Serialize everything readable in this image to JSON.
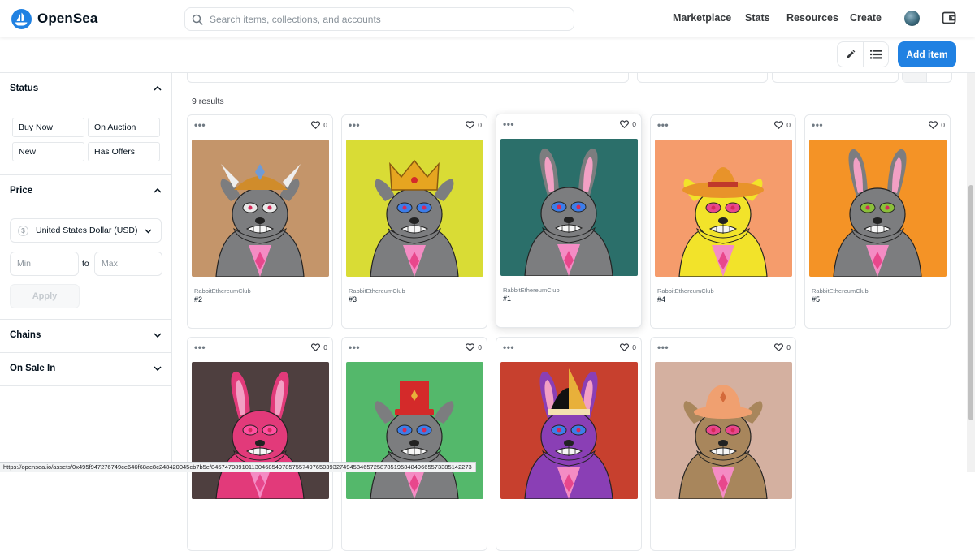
{
  "brand": {
    "name": "OpenSea",
    "accent": "#2081e2"
  },
  "search": {
    "placeholder": "Search items, collections, and accounts"
  },
  "nav": {
    "items": [
      "Marketplace",
      "Stats",
      "Resources",
      "Create"
    ]
  },
  "actions": {
    "add_item": "Add item",
    "edit_icon": "pencil-icon",
    "list_icon": "list-icon"
  },
  "sidebar": {
    "status": {
      "title": "Status",
      "options": [
        "Buy Now",
        "On Auction",
        "New",
        "Has Offers"
      ]
    },
    "price": {
      "title": "Price",
      "currency": "United States Dollar (USD)",
      "currency_symbol": "$",
      "min_placeholder": "Min",
      "max_placeholder": "Max",
      "to_label": "to",
      "apply_label": "Apply"
    },
    "chains": {
      "title": "Chains"
    },
    "on_sale_in": {
      "title": "On Sale In"
    }
  },
  "main": {
    "results_label": "9 results",
    "cards": [
      {
        "collection": "RabbitEthereumClub",
        "name": "#2",
        "likes": "0",
        "bg": "#c4956a",
        "fur": "#7c7d7f",
        "accent": "#e8e8e8",
        "hat": "viking-helmet",
        "hatColor": "#d08c2b"
      },
      {
        "collection": "RabbitEthereumClub",
        "name": "#3",
        "likes": "0",
        "bg": "#d9dc35",
        "fur": "#7c7d7f",
        "accent": "#3d7de8",
        "hat": "crown",
        "hatColor": "#e6a520"
      },
      {
        "collection": "RabbitEthereumClub",
        "name": "#1",
        "likes": "0",
        "bg": "#2b6f6a",
        "fur": "#7c7d7f",
        "accent": "#3d7de8",
        "hat": "none",
        "hatColor": "#7c7d7f"
      },
      {
        "collection": "RabbitEthereumClub",
        "name": "#4",
        "likes": "0",
        "bg": "#f59c6c",
        "fur": "#f2e32a",
        "accent": "#e8478c",
        "hat": "sombrero",
        "hatColor": "#e8932a"
      },
      {
        "collection": "RabbitEthereumClub",
        "name": "#5",
        "likes": "0",
        "bg": "#f49326",
        "fur": "#7c7d7f",
        "accent": "#8bbf3a",
        "hat": "none",
        "hatColor": "#7c7d7f"
      },
      {
        "collection": "",
        "name": "",
        "likes": "0",
        "bg": "#4e3f3f",
        "fur": "#e23a7a",
        "accent": "#ff4fa0",
        "hat": "none",
        "hatColor": "#e23a7a"
      },
      {
        "collection": "",
        "name": "",
        "likes": "0",
        "bg": "#54b86b",
        "fur": "#7c7d7f",
        "accent": "#3d7de8",
        "hat": "top-hat",
        "hatColor": "#d42a2a"
      },
      {
        "collection": "",
        "name": "",
        "likes": "0",
        "bg": "#c7402e",
        "fur": "#8a3fb5",
        "accent": "#3d7de8",
        "hat": "jester",
        "hatColor": "#e8b03a"
      },
      {
        "collection": "",
        "name": "",
        "likes": "0",
        "bg": "#d4b0a0",
        "fur": "#a8865c",
        "accent": "#e8478c",
        "hat": "bucket-hat",
        "hatColor": "#f0a070"
      }
    ]
  },
  "status_bar": {
    "url": "https://opensea.io/assets/0x495f947276749ce646f68ac8c248420045cb7b5e/84574798910113046854978575574976503932749458465725878519584849665573385142273"
  }
}
